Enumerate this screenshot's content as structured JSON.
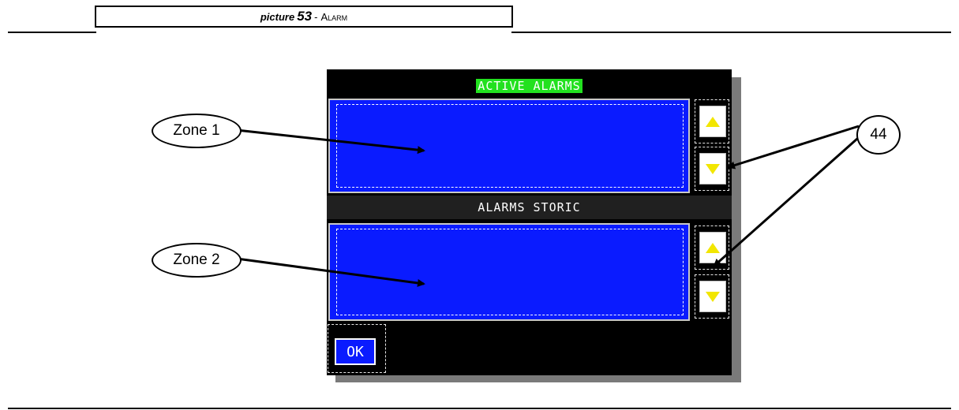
{
  "caption": {
    "prefix": "picture",
    "number": "53",
    "separator": "-",
    "title": "Alarm"
  },
  "screen": {
    "active_header": "ACTIVE ALARMS",
    "storic_header": "ALARMS STORIC",
    "ok_label": "OK"
  },
  "callouts": {
    "zone1": "Zone 1",
    "zone2": "Zone 2",
    "ref": "44"
  },
  "colors": {
    "active_bg": "#22e11f",
    "zone_blue": "#0a1bff",
    "arrow_yellow": "#f2e600"
  }
}
